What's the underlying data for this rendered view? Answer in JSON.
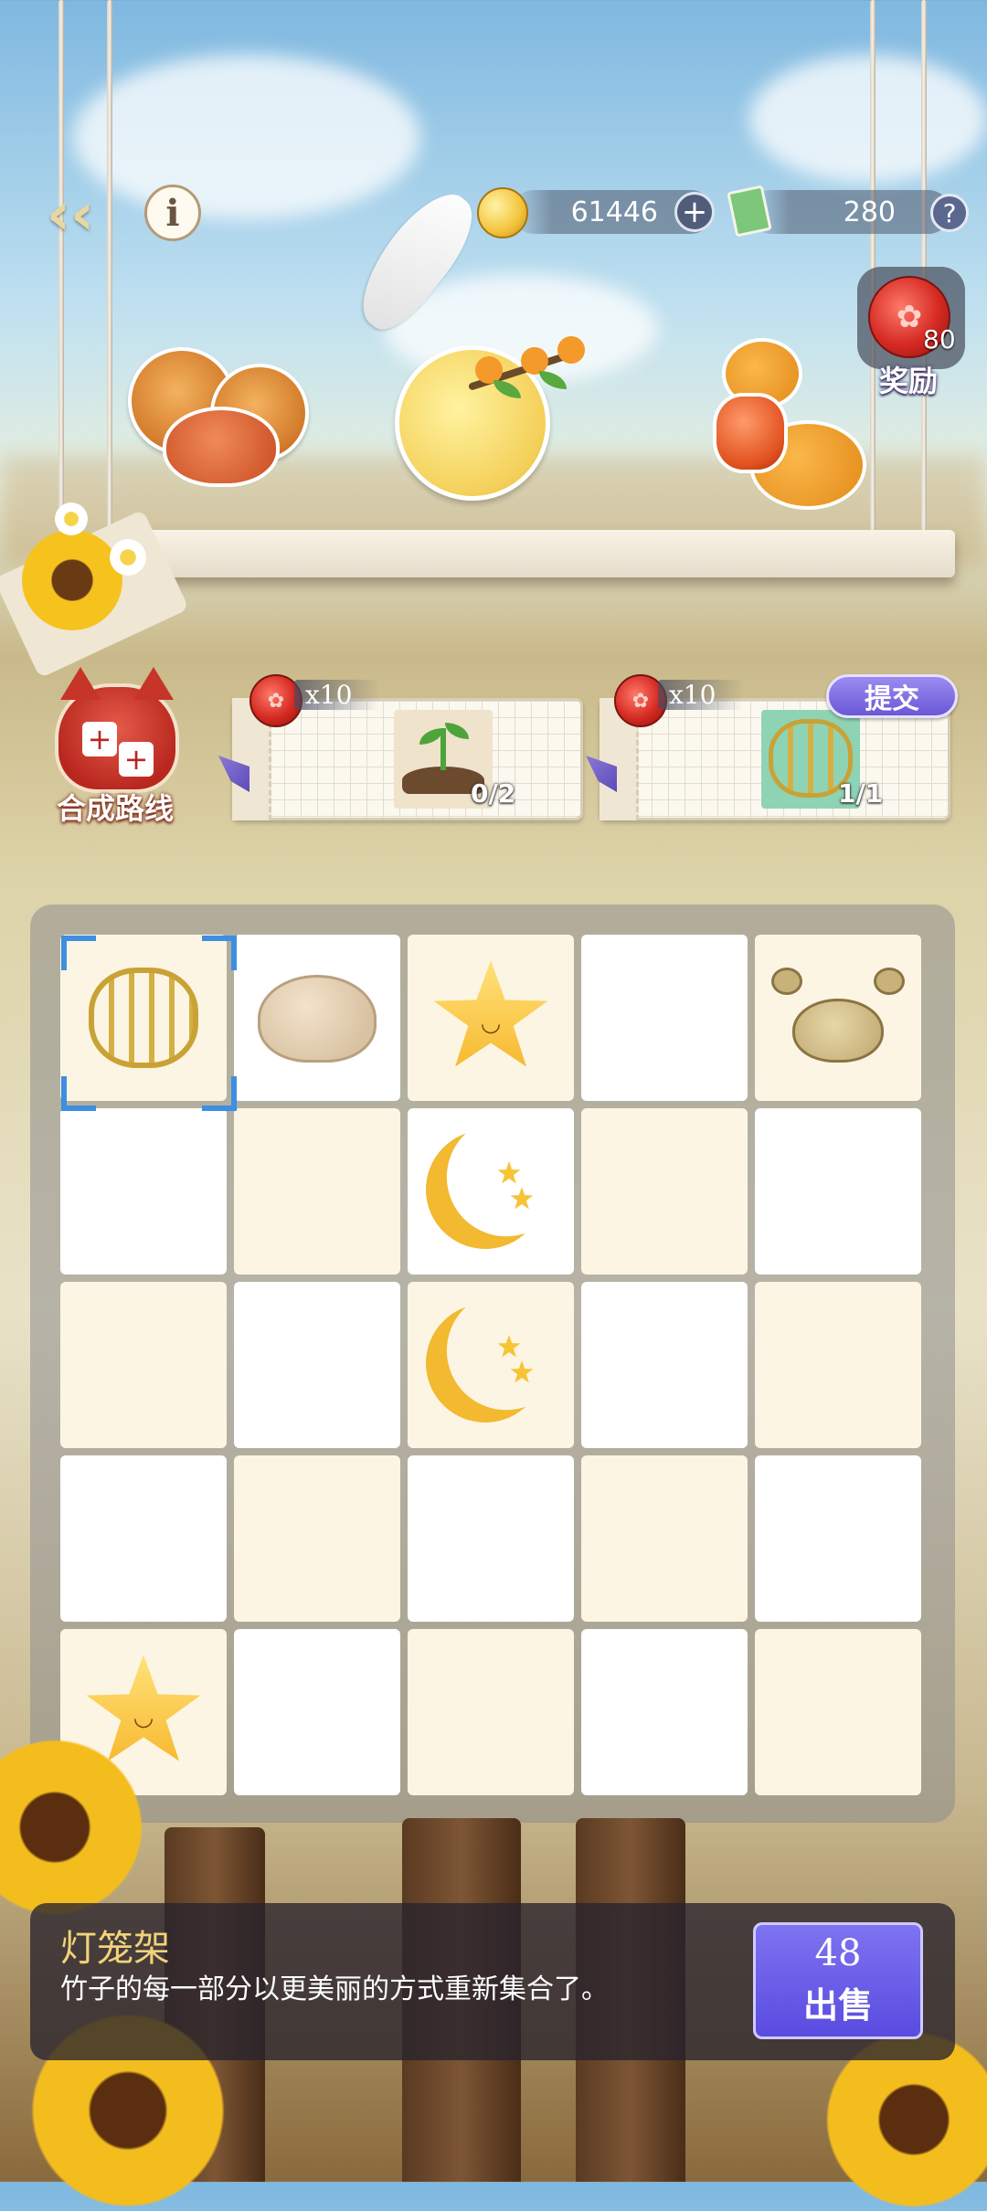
{
  "topbar": {
    "back_icon": "back-arrow-icon",
    "info_glyph": "i",
    "coins": "61446",
    "coins_plus": "+",
    "tickets": "280",
    "help_glyph": "?"
  },
  "reward": {
    "count": "80",
    "label": "奖励"
  },
  "shelf": {
    "items": [
      "mooncakes-and-crab",
      "osmanthus-moon",
      "snake-with-lantern"
    ]
  },
  "route": {
    "label": "合成路线"
  },
  "orders": [
    {
      "multiplier": "x10",
      "item": "sprout",
      "progress": "0/2"
    },
    {
      "multiplier": "x10",
      "item": "lantern-frame",
      "progress": "1/1",
      "submit_label": "提交"
    }
  ],
  "board": {
    "rows": 5,
    "cols": 5,
    "selected_cell": "r1c1",
    "cells": [
      [
        "lantern-frame",
        "mochi",
        "star",
        "",
        "crab"
      ],
      [
        "",
        "",
        "moon",
        "",
        ""
      ],
      [
        "",
        "",
        "moon",
        "",
        ""
      ],
      [
        "",
        "",
        "",
        "",
        ""
      ],
      [
        "star",
        "",
        "",
        "",
        ""
      ]
    ]
  },
  "info": {
    "name": "灯笼架",
    "description": "竹子的每一部分以更美丽的方式重新集合了。",
    "sell_price": "48",
    "sell_label": "出售"
  },
  "colors": {
    "accent": "#6a58d6",
    "selection": "#3e8ee2",
    "seal": "#d52a22"
  }
}
